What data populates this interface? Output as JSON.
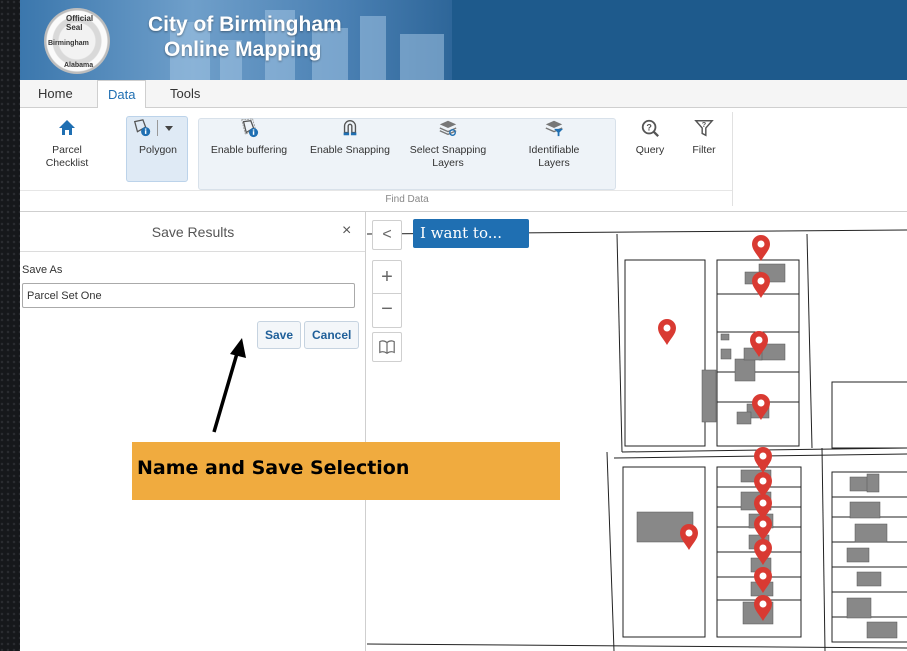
{
  "app": {
    "title_line1": "City of Birmingham",
    "title_line2": "Online Mapping",
    "seal_top_text": "Official Seal",
    "seal_side_text": "Birmingham",
    "seal_bottom_text": "Alabama"
  },
  "tabs": [
    {
      "label": "Home",
      "active": false
    },
    {
      "label": "Data",
      "active": true
    },
    {
      "label": "Tools",
      "active": false
    }
  ],
  "ribbon": {
    "parcel_checklist": {
      "label": "Parcel Checklist",
      "icon": "house-icon"
    },
    "polygon": {
      "label": "Polygon",
      "icon": "polygon-info-icon"
    },
    "enable_buffering": {
      "label": "Enable buffering",
      "icon": "buffer-icon"
    },
    "enable_snapping": {
      "label": "Enable Snapping",
      "icon": "magnet-icon"
    },
    "select_snapping_layers": {
      "label": "Select Snapping Layers",
      "icon": "layers-icon"
    },
    "identifiable_layers": {
      "label": "Identifiable Layers",
      "icon": "layers-filter-icon"
    },
    "query": {
      "label": "Query",
      "icon": "query-icon"
    },
    "filter": {
      "label": "Filter",
      "icon": "filter-icon"
    },
    "group_label": "Find Data"
  },
  "panel": {
    "title": "Save Results",
    "close_glyph": "×",
    "save_as_label": "Save As",
    "save_as_value": "Parcel Set One",
    "save_label": "Save",
    "cancel_label": "Cancel"
  },
  "annotation": {
    "text": "Name and Save Selection",
    "color": "#f0ab3f"
  },
  "map": {
    "collapse_glyph": "<",
    "zoom_in_glyph": "+",
    "zoom_out_glyph": "−",
    "iwant_label": "I want to...",
    "marker_color": "#d93a32",
    "marker_count": 15
  },
  "colors": {
    "accent": "#1f6fb2",
    "banner": "#1e5a8c"
  }
}
